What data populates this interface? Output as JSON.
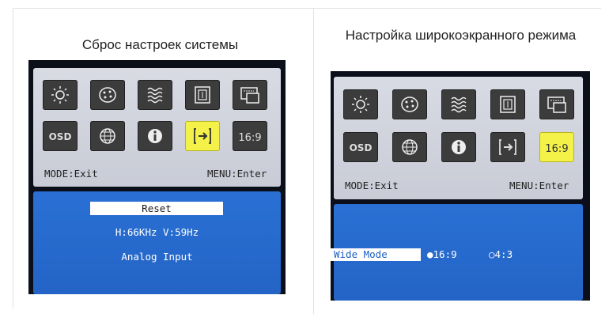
{
  "left_panel": {
    "caption": "Сброс настроек системы",
    "osd": {
      "icons": [
        {
          "name": "brightness-icon",
          "selected": false
        },
        {
          "name": "color-icon",
          "selected": false
        },
        {
          "name": "image-settings-icon",
          "selected": false
        },
        {
          "name": "position-icon",
          "selected": false
        },
        {
          "name": "menu-settings-icon",
          "selected": false
        },
        {
          "name": "osd-icon",
          "selected": false
        },
        {
          "name": "language-icon",
          "selected": false
        },
        {
          "name": "information-icon",
          "selected": false
        },
        {
          "name": "reset-icon",
          "selected": true
        },
        {
          "name": "wide-mode-icon",
          "selected": false
        }
      ],
      "osd_icon_text": "OSD",
      "wide_icon_text": "16:9",
      "mode_hint": "MODE:Exit",
      "menu_hint": "MENU:Enter",
      "reset_label": "Reset",
      "frequency": "H:66KHz V:59Hz",
      "input": "Analog Input"
    }
  },
  "right_panel": {
    "caption": "Настройка широкоэкранного режима",
    "osd": {
      "osd_icon_text": "OSD",
      "wide_icon_text": "16:9",
      "mode_hint": "MODE:Exit",
      "menu_hint": "MENU:Enter",
      "wide_mode_label": "Wide Mode",
      "option_16_9": "16:9",
      "option_4_3": "4:3",
      "selected_option": "16:9"
    }
  },
  "colors": {
    "highlight": "#f4f148",
    "osd_blue": "#2468cc",
    "icon_bg": "#3c3c3c"
  }
}
